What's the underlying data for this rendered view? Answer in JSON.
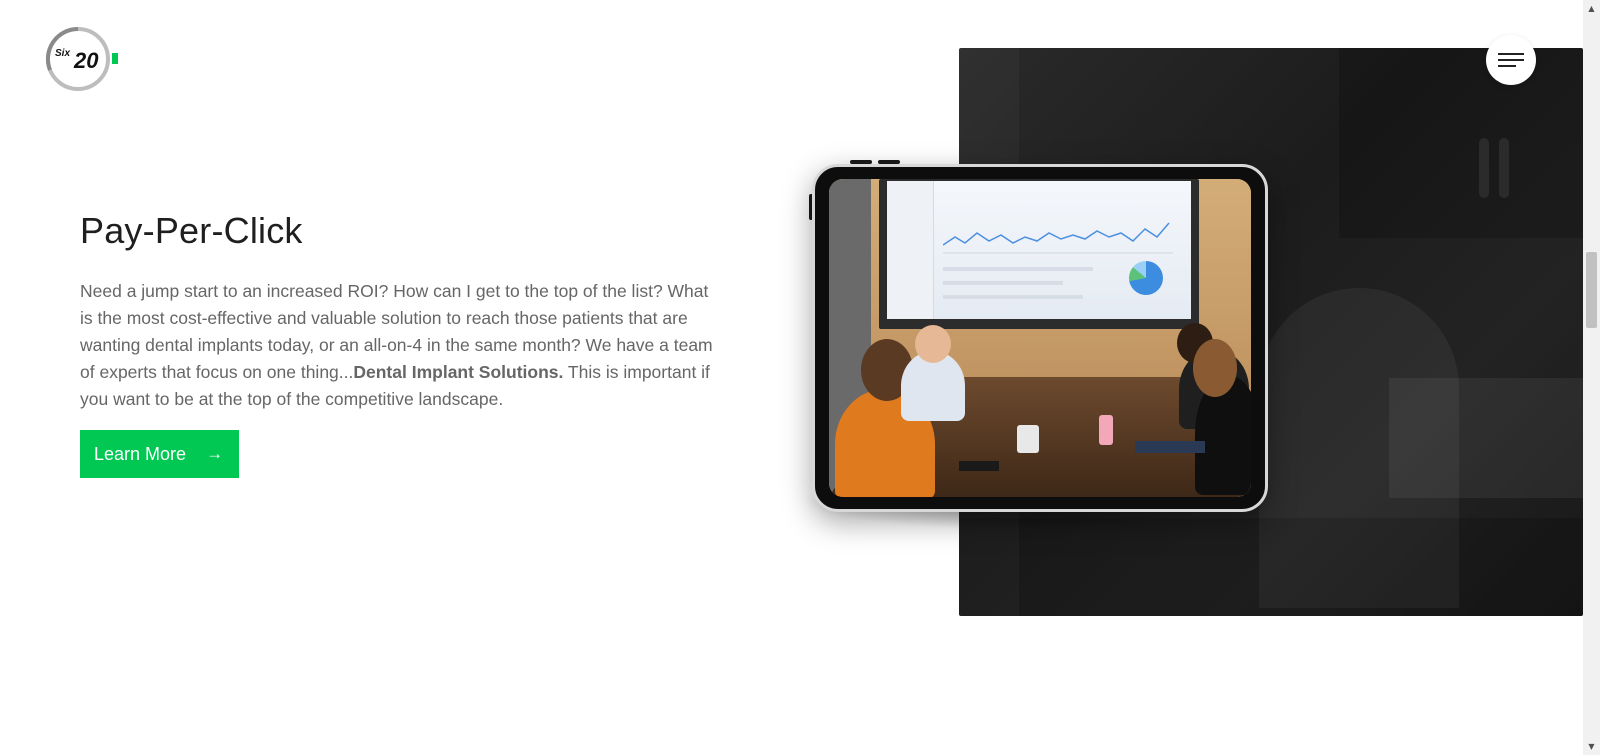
{
  "logo": {
    "prefix": "Six",
    "number": "20",
    "alt": "Six:20 logo"
  },
  "section": {
    "heading": "Pay-Per-Click",
    "body_before": "Need a jump start to an increased ROI? How can I get to the top of the list? What is the most cost-effective and valuable solution to reach those patients that are wanting dental implants today, or an all-on-4 in the same month? We have a team of experts that focus on one thing...",
    "body_bold": "Dental Implant Solutions.",
    "body_after": " This is important if you want to be at the top of the competitive landscape.",
    "cta_label": "Learn More",
    "cta_icon": "arrow-right-icon"
  },
  "menu": {
    "icon": "hamburger-menu-icon"
  },
  "colors": {
    "accent": "#00c853",
    "heading": "#1f1f1f",
    "body": "#666666",
    "panel": "#222222"
  }
}
